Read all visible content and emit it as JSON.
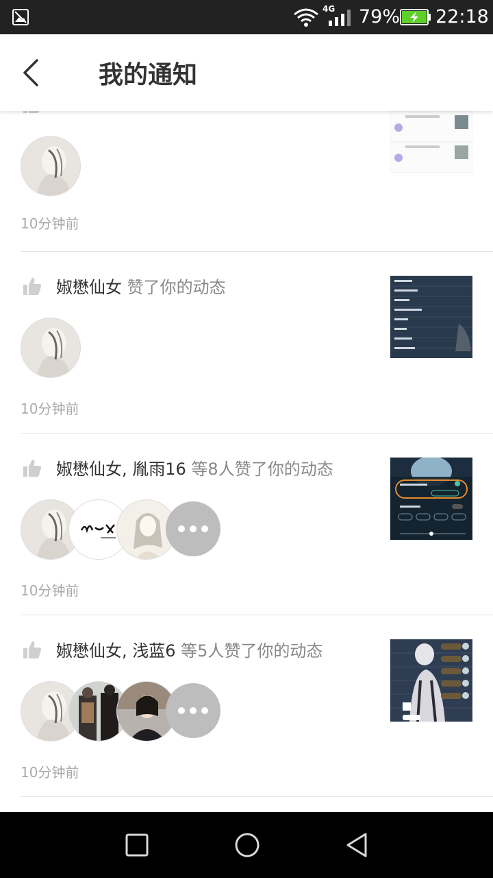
{
  "status_bar": {
    "network_type": "4G",
    "battery_percent": "79%",
    "time": "22:18",
    "colors": {
      "background": "#222222",
      "battery_fill": "#5fcf2b"
    }
  },
  "header": {
    "title": "我的通知"
  },
  "notifications": [
    {
      "user": "",
      "message_suffix": "",
      "time": "10分钟前",
      "avatar_count": 1,
      "has_more": false
    },
    {
      "user": "婌懋仙女",
      "message_suffix": " 赞了你的动态",
      "time": "10分钟前",
      "avatar_count": 1,
      "has_more": false
    },
    {
      "user": "婌懋仙女, 胤雨16",
      "message_suffix": " 等8人赞了你的动态",
      "time": "10分钟前",
      "avatar_count": 3,
      "has_more": true
    },
    {
      "user": "婌懋仙女, 浅蓝6",
      "message_suffix": " 等5人赞了你的动态",
      "time": "10分钟前",
      "avatar_count": 3,
      "has_more": true
    }
  ],
  "colors": {
    "text_primary": "#333333",
    "text_secondary": "#888888",
    "time": "#a9a9a9",
    "more_avatar": "#bdbdbd",
    "divider": "#e3e3e3"
  },
  "icons": [
    "gallery-icon",
    "wifi-icon",
    "signal-icon",
    "battery-icon",
    "back-arrow-icon",
    "thumbs-up-icon",
    "more-dots-icon",
    "recent-apps-icon",
    "home-icon",
    "back-triangle-icon"
  ]
}
